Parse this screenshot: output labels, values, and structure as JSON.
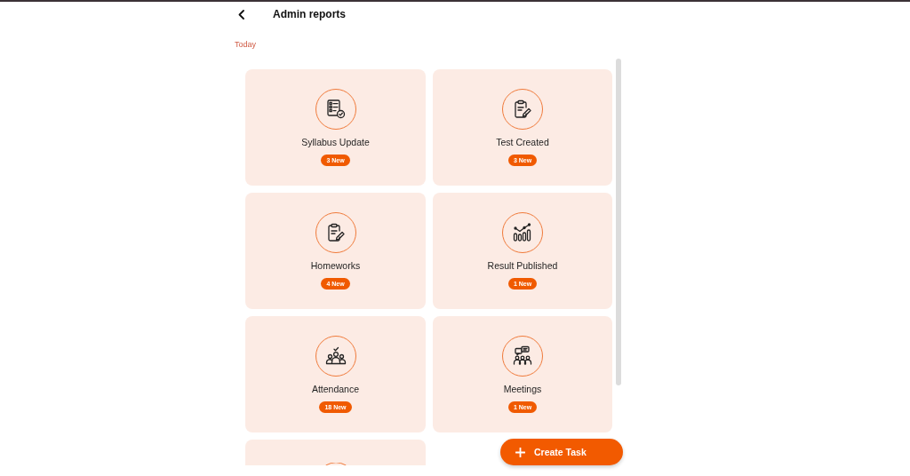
{
  "header": {
    "title": "Admin reports"
  },
  "section": {
    "label": "Today"
  },
  "cards": [
    {
      "kind": "tile",
      "title": "Syllabus Update",
      "badge": "3 New"
    },
    {
      "kind": "tile",
      "title": "Test Created",
      "badge": "3 New"
    },
    {
      "kind": "tile",
      "title": "Homeworks",
      "badge": "4 New"
    },
    {
      "kind": "tile",
      "title": "Result Published",
      "badge": "1 New"
    },
    {
      "kind": "tile",
      "title": "Attendance",
      "badge": "18 New"
    },
    {
      "kind": "tile",
      "title": "Meetings",
      "badge": "1 New"
    },
    {
      "kind": "cut"
    }
  ],
  "fab": {
    "label": "Create Task"
  }
}
